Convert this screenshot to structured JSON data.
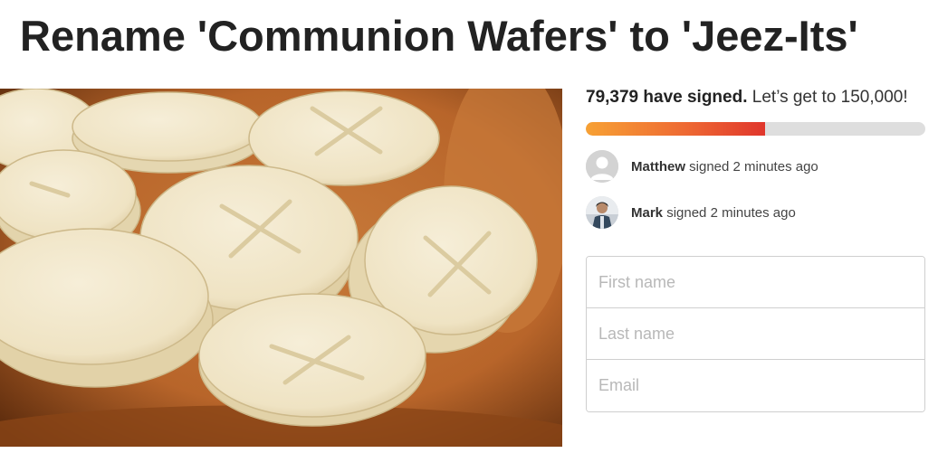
{
  "petition": {
    "title": "Rename 'Communion Wafers' to 'Jeez-Its'"
  },
  "hero_image": {
    "subject": "wooden bowl of communion wafers",
    "colors": {
      "bowl": "#b8652a",
      "bowl_dark": "#5a2a0c",
      "wafer": "#f1e7cc",
      "wafer_shadow": "#d8c69c"
    }
  },
  "stats": {
    "signed_count": "79,379 have signed.",
    "goal_text": " Let’s get to 150,000!",
    "progress_fraction": 0.5292,
    "progress_colors": {
      "start": "#f7a134",
      "end": "#e0362c",
      "track": "#dedede"
    }
  },
  "recent_signers": [
    {
      "name": "Matthew",
      "action": " signed 2 minutes ago",
      "avatar": "default-avatar-icon"
    },
    {
      "name": "Mark",
      "action": " signed 2 minutes ago",
      "avatar": "user-photo"
    }
  ],
  "form": {
    "first_name_placeholder": "First name",
    "last_name_placeholder": "Last name",
    "email_placeholder": "Email"
  }
}
